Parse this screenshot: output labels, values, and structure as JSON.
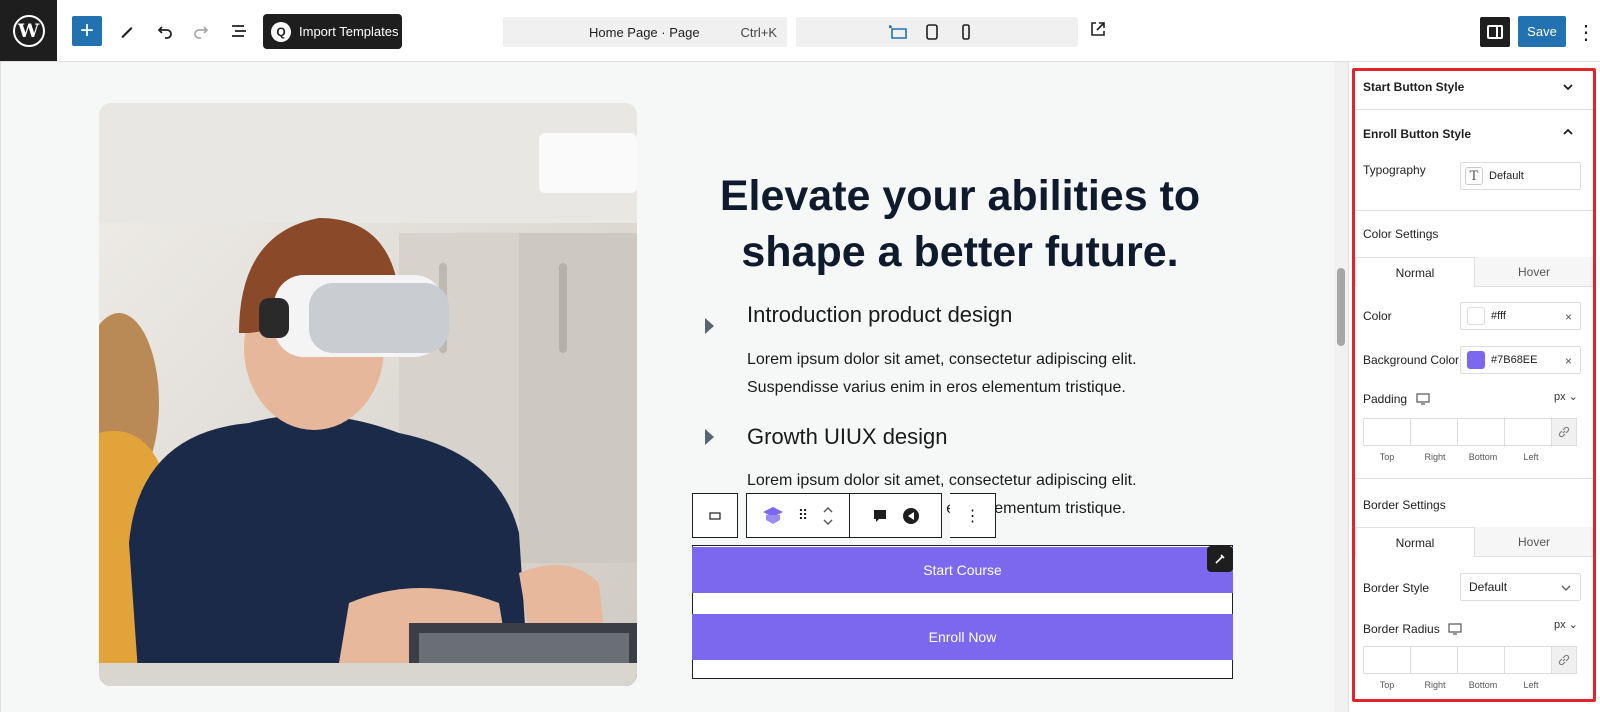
{
  "toolbar": {
    "import_label": "Import Templates",
    "page_title": "Home Page · Page",
    "shortcut": "Ctrl+K",
    "save_label": "Save"
  },
  "content": {
    "headline": "Elevate your abilities to shape a better future.",
    "items": [
      {
        "title": "Introduction product design",
        "text": "Lorem ipsum dolor sit amet, consectetur adipiscing elit. Suspendisse varius enim in eros elementum tristique."
      },
      {
        "title": "Growth UIUX design",
        "text": "Lorem ipsum dolor sit amet, consectetur adipiscing elit. Suspendisse varius enim in eros elementum tristique."
      }
    ],
    "start_button": "Start Course",
    "enroll_button": "Enroll Now"
  },
  "sidebar": {
    "start_section": "Start Button Style",
    "enroll_section": "Enroll Button Style",
    "typography_label": "Typography",
    "typography_value": "Default",
    "color_settings": "Color Settings",
    "tab_normal": "Normal",
    "tab_hover": "Hover",
    "color_label": "Color",
    "color_value": "#fff",
    "bg_color_label": "Background Color",
    "bg_color_value": "#7B68EE",
    "padding_label": "Padding",
    "unit": "px",
    "box_labels": {
      "top": "Top",
      "right": "Right",
      "bottom": "Bottom",
      "left": "Left"
    },
    "border_settings": "Border Settings",
    "border_style_label": "Border Style",
    "border_style_value": "Default",
    "border_radius_label": "Border Radius"
  },
  "colors": {
    "accent": "#2271b1",
    "button_bg": "#7B68EE",
    "highlight": "#e0242a"
  },
  "icons": [
    "wordpress-icon",
    "plus-icon",
    "pen-icon",
    "undo-icon",
    "redo-icon",
    "list-view-icon",
    "desktop-icon",
    "tablet-icon",
    "mobile-icon",
    "external-link-icon",
    "sidebar-toggle-icon",
    "more-vertical-icon",
    "chevron-down-icon",
    "chevron-up-icon",
    "link-icon",
    "monitor-icon"
  ]
}
